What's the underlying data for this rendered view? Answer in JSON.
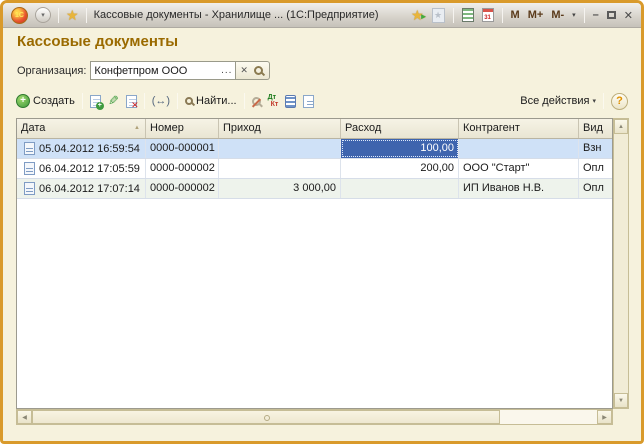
{
  "colors": {
    "window_border": "#d99a2b",
    "page_background": "#f6f2dd",
    "page_title_text": "#9a6a00",
    "selected_row_bg": "#cfe1f7",
    "selected_cell_bg": "#3e64ae",
    "selected_cell_text": "#ffffff"
  },
  "titlebar": {
    "logo": "1С",
    "title": "Кассовые документы - Хранилище ...  (1С:Предприятие)",
    "calendar_day": "31",
    "memory": {
      "m": "M",
      "m_plus": "M+",
      "m_minus": "M-"
    },
    "window_buttons": {
      "minimize": "–",
      "close": "✕"
    },
    "dropdown_glyph": "▾"
  },
  "page": {
    "title": "Кассовые документы"
  },
  "organization": {
    "label": "Организация:",
    "value": "Конфетпром ООО",
    "choose_button": "...",
    "clear_button": "✕"
  },
  "toolbar": {
    "create": "Создать",
    "find": "Найти...",
    "interval_icon": "(↔)",
    "dt": "Дт",
    "kt": "Кт",
    "all_actions": "Все действия",
    "all_actions_arrow": "▾",
    "help": "?"
  },
  "table": {
    "columns": [
      "Дата",
      "Номер",
      "Приход",
      "Расход",
      "Контрагент",
      "Вид"
    ],
    "sort_icon": "▲",
    "rows": [
      {
        "date": "05.04.2012 16:59:54",
        "number": "0000-000001",
        "prihod": "",
        "rashod": "100,00",
        "kontragent": "",
        "vid": "Взн"
      },
      {
        "date": "06.04.2012 17:05:59",
        "number": "0000-000002",
        "prihod": "",
        "rashod": "200,00",
        "kontragent": "ООО \"Старт\"",
        "vid": "Опл"
      },
      {
        "date": "06.04.2012 17:07:14",
        "number": "0000-000002",
        "prihod": "3 000,00",
        "rashod": "",
        "kontragent": "ИП Иванов Н.В.",
        "vid": "Опл"
      }
    ]
  },
  "scrollbars": {
    "up": "▲",
    "down": "▼",
    "left": "◀",
    "right": "▶"
  }
}
